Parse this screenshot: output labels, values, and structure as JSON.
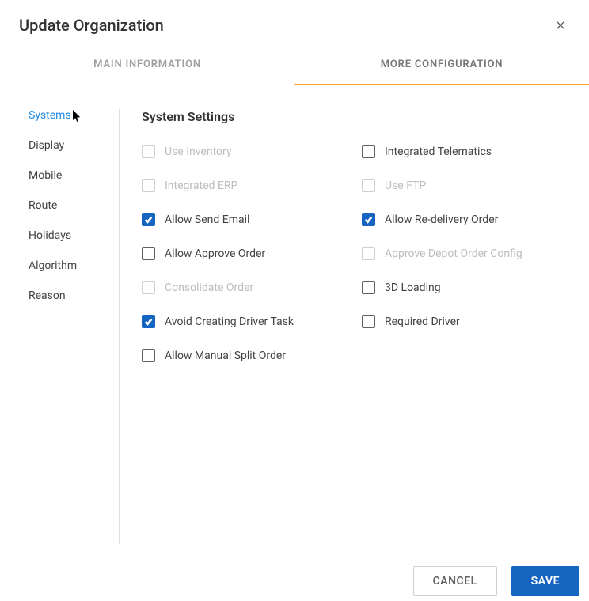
{
  "header": {
    "title": "Update Organization"
  },
  "tabs": {
    "main": "MAIN INFORMATION",
    "more": "MORE CONFIGURATION"
  },
  "sidebar": {
    "items": [
      {
        "label": "Systems",
        "active": true
      },
      {
        "label": "Display"
      },
      {
        "label": "Mobile"
      },
      {
        "label": "Route"
      },
      {
        "label": "Holidays"
      },
      {
        "label": "Algorithm"
      },
      {
        "label": "Reason"
      }
    ]
  },
  "section": {
    "title": "System Settings"
  },
  "settings": {
    "use_inventory": "Use Inventory",
    "integrated_telematics": "Integrated Telematics",
    "integrated_erp": "Integrated ERP",
    "use_ftp": "Use FTP",
    "allow_send_email": "Allow Send Email",
    "allow_redelivery": "Allow Re-delivery Order",
    "allow_approve_order": "Allow Approve Order",
    "approve_depot": "Approve Depot Order Config",
    "consolidate_order": "Consolidate Order",
    "three_d_loading": "3D Loading",
    "avoid_driver_task": "Avoid Creating Driver Task",
    "required_driver": "Required Driver",
    "allow_manual_split": "Allow Manual Split Order"
  },
  "footer": {
    "cancel": "CANCEL",
    "save": "SAVE"
  }
}
